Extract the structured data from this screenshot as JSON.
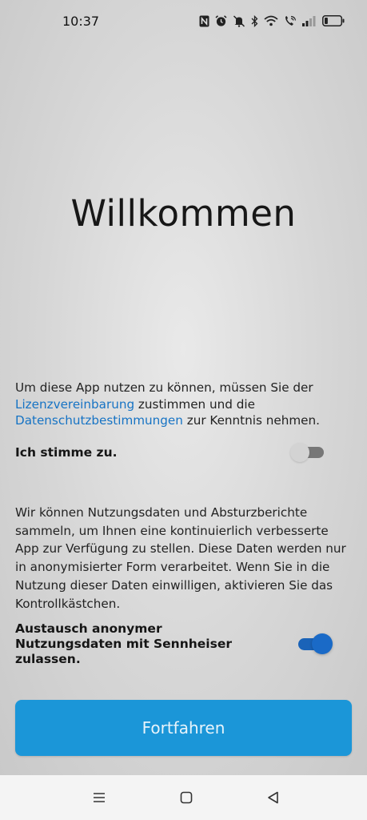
{
  "status_bar": {
    "time": "10:37",
    "icons": [
      "nfc-icon",
      "alarm-icon",
      "mute-icon",
      "bluetooth-icon",
      "wifi-icon",
      "wifi-calling-icon",
      "signal-icon",
      "battery-icon"
    ],
    "battery_level": 0.2
  },
  "welcome": {
    "title": "Willkommen"
  },
  "license": {
    "text_before": "Um diese App nutzen zu können, müssen Sie der ",
    "link_license": "Lizenzvereinbarung",
    "text_middle": " zustimmen und die ",
    "link_privacy": "Datenschutzbestimmungen",
    "text_after": " zur Kenntnis nehmen.",
    "agree_label": "Ich stimme zu.",
    "agree_checked": false
  },
  "usage": {
    "text": "Wir können Nutzungsdaten und Absturzberichte sammeln, um Ihnen eine kontinuierlich verbesserte App zur Verfügung zu stellen. Diese Daten werden nur in anonymisierter Form verarbeitet. Wenn Sie in die Nutzung dieser Daten einwilligen, aktivieren Sie das Kontrollkästchen.",
    "toggle_label": "Austausch anonymer Nutzungsdaten mit Sennheiser zulassen.",
    "toggle_checked": true
  },
  "actions": {
    "continue_label": "Fortfahren"
  },
  "colors": {
    "link": "#1673c4",
    "button": "#1b96d8",
    "toggle_on": "#1a63b8"
  },
  "nav": {
    "icons": [
      "menu-icon",
      "home-square-icon",
      "back-triangle-icon"
    ]
  }
}
